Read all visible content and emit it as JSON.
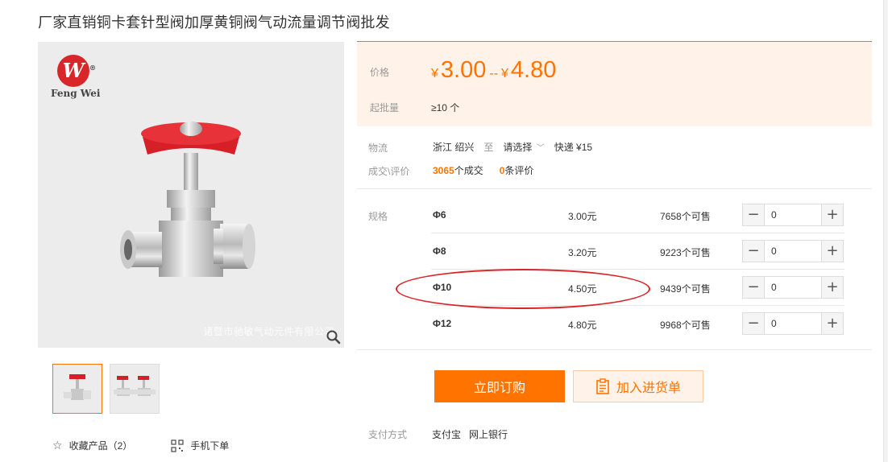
{
  "title": "厂家直销铜卡套针型阀加厚黄铜阀气动流量调节阀批发",
  "gallery": {
    "logo_text": "Feng Wei",
    "logo_mark": "W",
    "watermark": "诸暨市驰敏气动元件有限公司"
  },
  "actions": {
    "favorite_label": "收藏产品（2）",
    "mobile_order_label": "手机下单"
  },
  "price": {
    "label": "价格",
    "currency": "¥",
    "min": "3.00",
    "separator": "--",
    "max": "4.80",
    "moq_label": "起批量",
    "moq_value": "≥10 个"
  },
  "logistics": {
    "label": "物流",
    "origin": "浙江 绍兴",
    "to": "至",
    "destination": "请选择",
    "shipping": "快递 ¥15"
  },
  "deals": {
    "label": "成交\\评价",
    "deal_count": "3065",
    "deal_suffix": "个成交",
    "review_count": "0",
    "review_suffix": "条评价"
  },
  "specs": {
    "label": "规格",
    "rows": [
      {
        "name": "Φ6",
        "price": "3.00元",
        "stock": "7658个可售",
        "qty": "0"
      },
      {
        "name": "Φ8",
        "price": "3.20元",
        "stock": "9223个可售",
        "qty": "0"
      },
      {
        "name": "Φ10",
        "price": "4.50元",
        "stock": "9439个可售",
        "qty": "0"
      },
      {
        "name": "Φ12",
        "price": "4.80元",
        "stock": "9968个可售",
        "qty": "0"
      }
    ],
    "minus": "−",
    "plus": "+"
  },
  "buttons": {
    "buy_now": "立即订购",
    "add_cart": "加入进货单"
  },
  "payment": {
    "label": "支付方式",
    "methods": [
      "支付宝",
      "网上银行"
    ]
  },
  "colors": {
    "accent": "#ff7300",
    "highlight": "#d8262b"
  },
  "icons": [
    "zoom-icon",
    "star-icon",
    "qr-code-icon",
    "clipboard-icon",
    "chevron-down-icon"
  ]
}
